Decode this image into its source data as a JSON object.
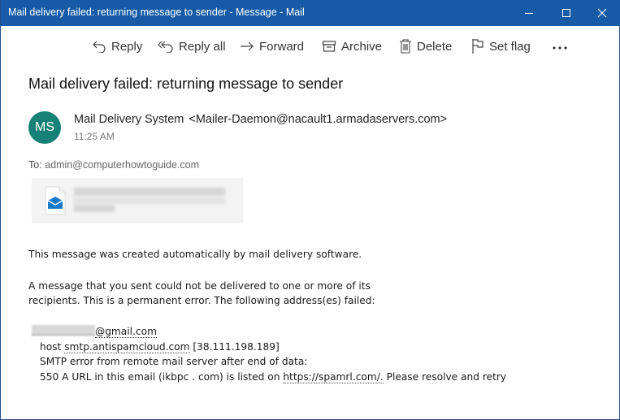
{
  "window": {
    "title": "Mail delivery failed: returning message to sender - Message - Mail",
    "controls": {
      "minimize": "minimize-icon",
      "maximize": "maximize-icon",
      "close": "close-icon"
    },
    "titlebar_color": "#175ba6"
  },
  "toolbar": {
    "items": [
      {
        "label": "Reply",
        "icon": "reply-icon"
      },
      {
        "label": "Reply all",
        "icon": "reply-all-icon"
      },
      {
        "label": "Forward",
        "icon": "forward-icon"
      },
      {
        "label": "Archive",
        "icon": "archive-icon"
      },
      {
        "label": "Delete",
        "icon": "delete-icon"
      },
      {
        "label": "Set flag",
        "icon": "flag-icon"
      }
    ],
    "more": "more-icon"
  },
  "message": {
    "subject": "Mail delivery failed: returning message to sender",
    "sender": {
      "initials": "MS",
      "avatar_color": "#168176",
      "name": "Mail Delivery System",
      "address": "<Mailer-Daemon@nacault1.armadaservers.com>"
    },
    "time": "11:25 AM",
    "to_label": "To:",
    "to": "admin@computerhowtoguide.com",
    "attachment": {
      "icon": "mail-file-icon",
      "name_redacted": true
    },
    "body": {
      "line1": "This message was created automatically by mail delivery software.",
      "line2": "A message that you sent could not be delivered to one or more of its",
      "line3": "recipients. This is a permanent error. The following address(es) failed:",
      "failed_address_suffix": "@gmail.com",
      "host_prefix": "host ",
      "host": "smtp.antispamcloud.com",
      "host_ip": " [38.111.198.189]",
      "smtp_error": "SMTP error from remote mail server after end of data:",
      "error_prefix": "550 A URL in this email (ikbpc . com) is listed on ",
      "error_link": "https://spamrl.com/.",
      "error_suffix": " Please resolve and retry"
    }
  }
}
